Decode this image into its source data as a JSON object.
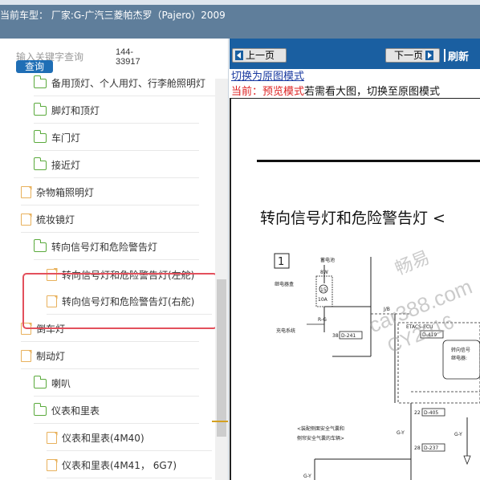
{
  "header": {
    "title": "当前车型： 厂家:G-广汽三菱帕杰罗（Pajero）2009"
  },
  "search": {
    "placeholder": "输入关键字查询",
    "button_label": "查询",
    "code_line1": "144-",
    "code_line2": "33917"
  },
  "tree": {
    "items": [
      {
        "label": "备用顶灯、个人用灯、行李舱照明灯",
        "icon": "folder-icon"
      },
      {
        "label": "脚灯和顶灯",
        "icon": "folder-icon"
      },
      {
        "label": "车门灯",
        "icon": "folder-icon"
      },
      {
        "label": "接近灯",
        "icon": "folder-icon"
      },
      {
        "label": "杂物箱照明灯",
        "icon": "document-icon"
      },
      {
        "label": "梳妆镜灯",
        "icon": "document-icon"
      },
      {
        "label": "转向信号灯和危险警告灯",
        "icon": "folder-icon"
      },
      {
        "label": "转向信号灯和危险警告灯(左舵)",
        "icon": "document-icon"
      },
      {
        "label": "转向信号灯和危险警告灯(右舵)",
        "icon": "document-icon"
      },
      {
        "label": "倒车灯",
        "icon": "document-icon"
      },
      {
        "label": "制动灯",
        "icon": "document-icon"
      },
      {
        "label": "喇叭",
        "icon": "folder-icon"
      },
      {
        "label": "仪表和里表",
        "icon": "folder-icon"
      },
      {
        "label": "仪表和里表(4M40)",
        "icon": "document-icon"
      },
      {
        "label": "仪表和里表(4M41， 6G7)",
        "icon": "document-icon"
      }
    ]
  },
  "toolbar": {
    "prev_label": "上一页",
    "next_label": "下一页",
    "refresh_label": "刷新"
  },
  "viewer": {
    "switch_link": "切换为原图模式",
    "mode_label": "当前：预览模式",
    "mode_hint": "若需看大图，切换至原图模式",
    "doc_title": "转向信号灯和危险警告灯 <"
  },
  "watermark": {
    "line1": "畅易",
    "line2": "car388.com",
    "line3": "CY2016"
  },
  "diagram": {
    "box_num": "1",
    "battery": "蓄电池",
    "wire_8w": "8W",
    "relay_box": "继电器盒",
    "fuse_num": "15",
    "fuse_amp": "10A",
    "wire_rg": "R-G",
    "charge_sys": "充电系统",
    "conn_38": "38",
    "conn_d241": "D-241",
    "jb": "J/B",
    "etacs": "ETACS-ECU",
    "conn_d419": "D-419",
    "turn_relay1": "转向信号",
    "turn_relay2": "继电器:",
    "conn_22": "22",
    "conn_d405": "D-405",
    "airbag1": "<装配侧面安全气囊和",
    "airbag2": "侧帘安全气囊的车辆>",
    "wire_gy1": "G-Y",
    "wire_gy2": "G-Y",
    "wire_gy3": "G-Y",
    "conn_28": "28",
    "conn_d237": "D-237"
  }
}
